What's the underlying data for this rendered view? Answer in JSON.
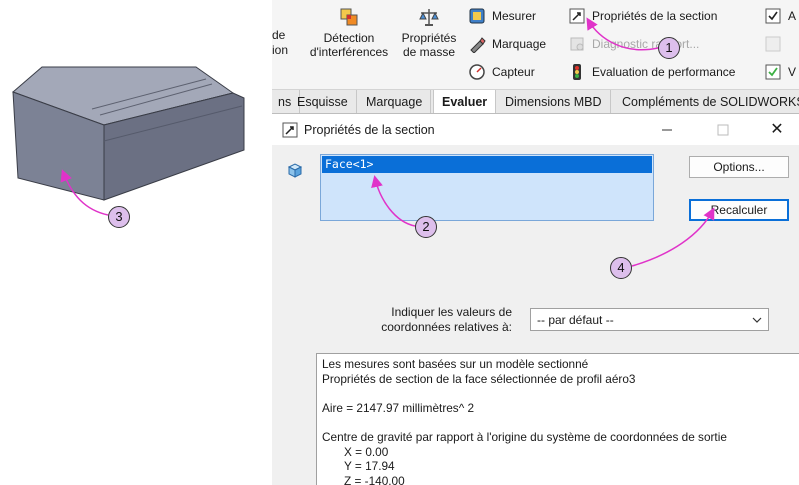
{
  "ribbon": {
    "cut_text_top": "de",
    "cut_text_bottom": "ion",
    "interference": {
      "line1": "Détection",
      "line2": "d'interférences",
      "icon": "interference-detection-icon"
    },
    "mass_props": {
      "line1": "Propriétés",
      "line2": "de masse",
      "icon": "mass-properties-icon"
    },
    "measure": {
      "label": "Mesurer",
      "icon": "measure-icon"
    },
    "markup": {
      "label": "Marquage",
      "icon": "markup-icon"
    },
    "sensor": {
      "label": "Capteur",
      "icon": "sensor-icon"
    },
    "section_props": {
      "label": "Propriétés de la section",
      "icon": "section-properties-icon"
    },
    "diagnostics": {
      "label": "Diagnostic rapport...",
      "icon": "diagnostics-icon",
      "disabled": true
    },
    "performance": {
      "label": "Evaluation de performance",
      "icon": "performance-evaluation-icon"
    },
    "col4_cut": [
      "A",
      "",
      "V"
    ]
  },
  "tabs": [
    {
      "label": "ns",
      "active": false
    },
    {
      "label": "Esquisse",
      "active": false
    },
    {
      "label": "Marquage",
      "active": false
    },
    {
      "label": "Evaluer",
      "active": true
    },
    {
      "label": "Dimensions MBD",
      "active": false
    },
    {
      "label": "Compléments de SOLIDWORKS",
      "active": false
    }
  ],
  "dialog": {
    "title": "Propriétés de la section",
    "selection_items": [
      "Face<1>"
    ],
    "options_button": "Options...",
    "recalc_button": "Recalculer",
    "coord_label_line1": "Indiquer les valeurs de",
    "coord_label_line2": "coordonnées relatives à:",
    "coord_select_value": "-- par défaut --",
    "results": [
      "Les mesures sont basées sur un modèle sectionné",
      "Propriétés de section de la face sélectionnée de profil aéro3",
      "",
      "Aire = 2147.97 millimètres^ 2",
      "",
      "Centre de gravité par rapport à l'origine du système de coordonnées de sortie",
      "X = 0.00",
      "Y = 17.94",
      "Z = -140.00"
    ]
  },
  "callouts": [
    "1",
    "2",
    "3",
    "4"
  ],
  "colors": {
    "selection_bg": "#0a6fd8",
    "list_bg": "#cfe4fb",
    "callout_fill": "#ddbfec",
    "arrow": "#e033c9",
    "model_face": "#7c8295"
  }
}
